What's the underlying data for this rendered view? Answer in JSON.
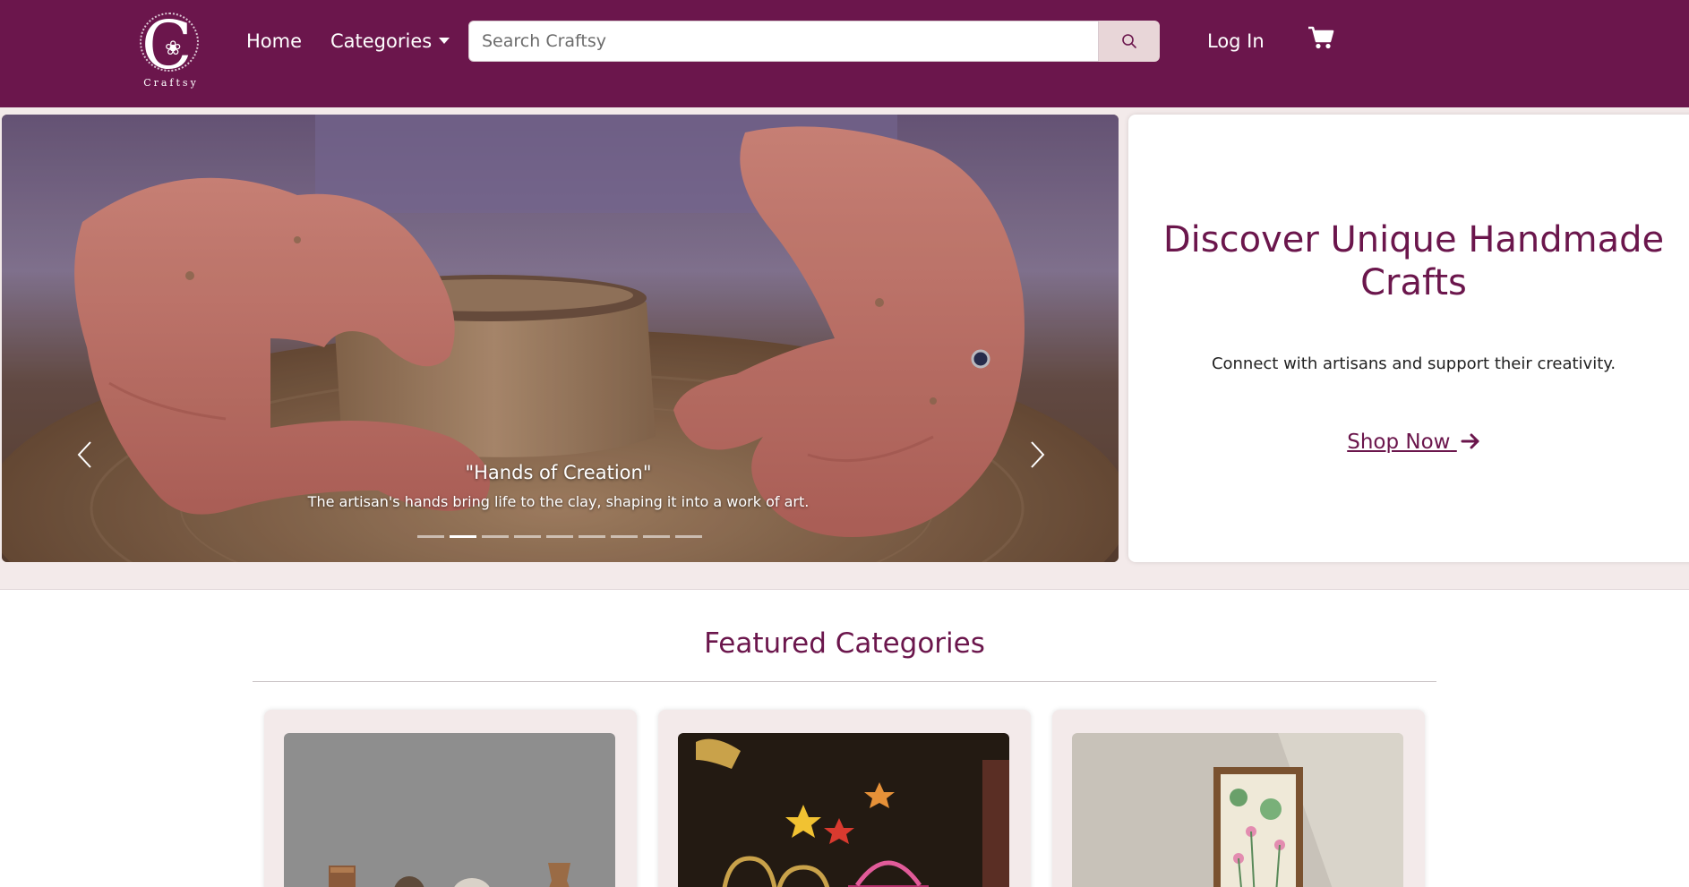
{
  "brand": {
    "logo_word": "Craftsy",
    "logo_ring_text": "HANDCRAFTED WITH LOVE"
  },
  "nav": {
    "home": "Home",
    "categories": "Categories",
    "login": "Log In",
    "cart_icon": "shopping-cart-icon",
    "search_icon": "search-icon"
  },
  "search": {
    "placeholder": "Search Craftsy",
    "value": ""
  },
  "carousel": {
    "caption_title": "\"Hands of Creation\"",
    "caption_text": "The artisan's hands bring life to the clay, shaping it into a work of art.",
    "slide_count": 9,
    "active_index": 1,
    "prev_icon": "chevron-left-icon",
    "next_icon": "chevron-right-icon"
  },
  "hero": {
    "title": "Discover Unique Handmade Crafts",
    "subtitle": "Connect with artisans and support their creativity.",
    "cta": "Shop Now",
    "cta_icon": "arrow-right-icon"
  },
  "featured": {
    "title": "Featured Categories",
    "cards": [
      {
        "image": "pottery-vases-photo"
      },
      {
        "image": "woven-baskets-photo"
      },
      {
        "image": "framed-lotus-painting-photo"
      }
    ]
  },
  "colors": {
    "brand": "#6b164c",
    "page_bg": "#f3eaea",
    "search_button_bg": "#e8d6d8"
  }
}
